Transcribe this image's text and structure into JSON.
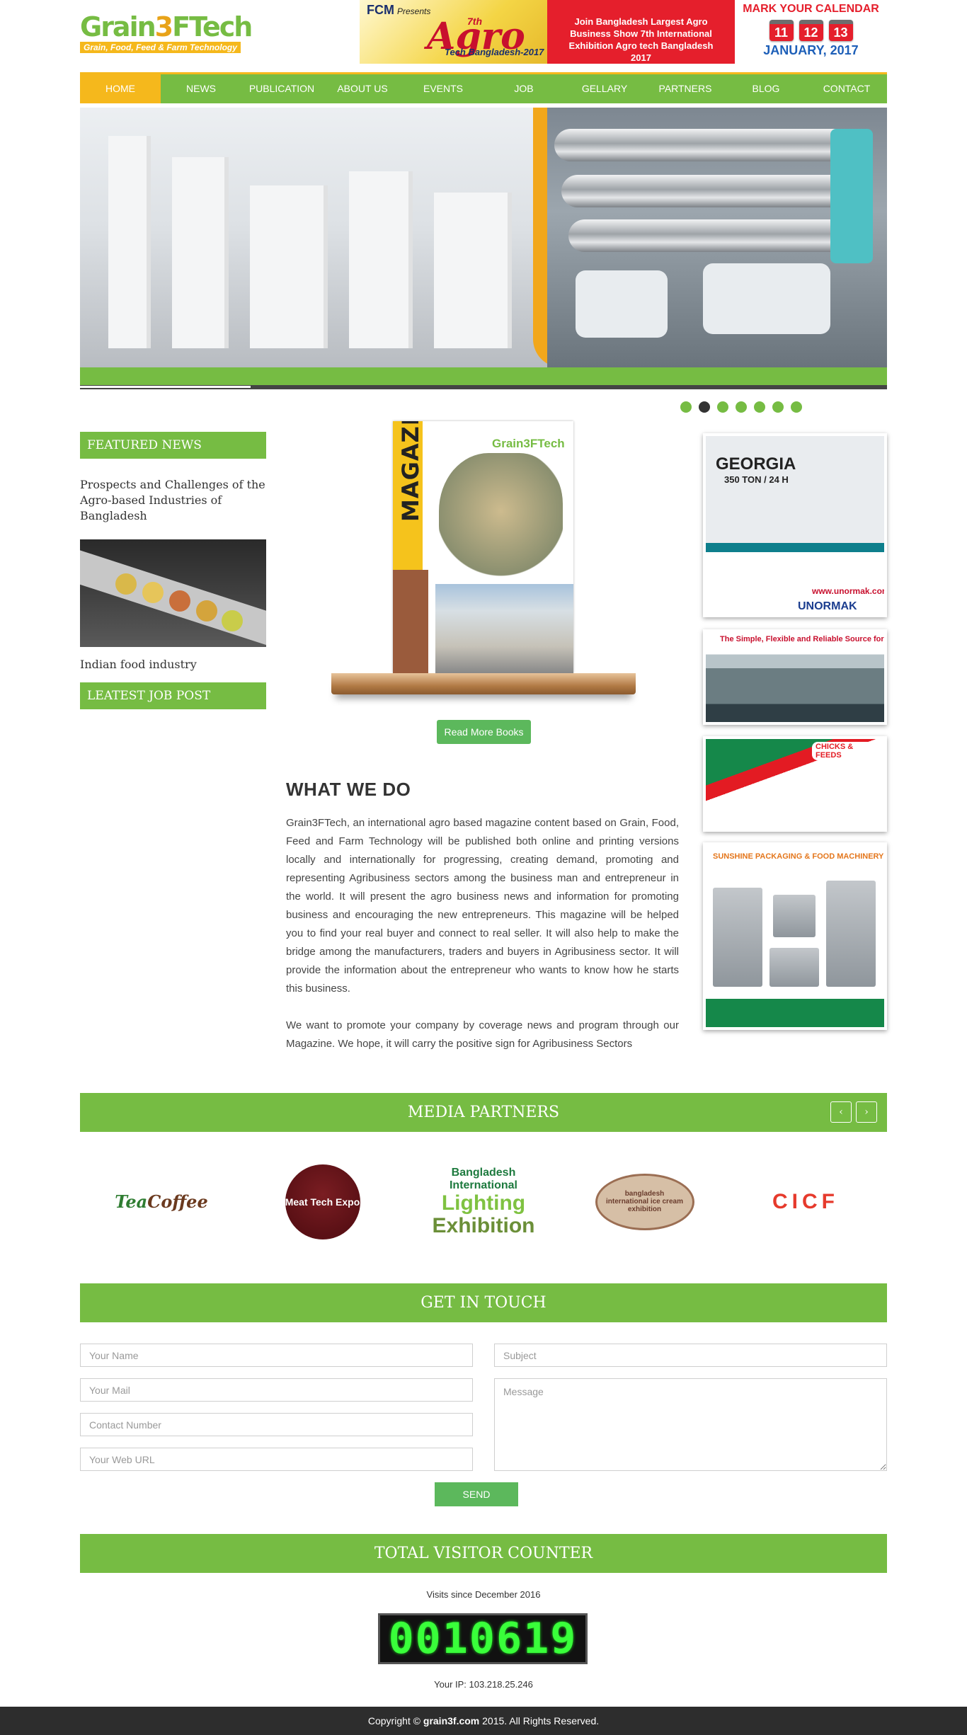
{
  "logo": {
    "name_a": "Grain",
    "name_b": "3",
    "name_c": "FTech",
    "tagline": "Grain, Food, Feed & Farm Technology"
  },
  "banner": {
    "fcm": "FCM",
    "presents": "Presents",
    "seventh": "7th",
    "agro": "Agro",
    "sub": "Tech Bangladesh-2017",
    "join_text": "Join Bangladesh Largest Agro Business Show 7th International Exhibition Agro tech Bangladesh 2017",
    "calendar_head": "MARK YOUR CALENDAR",
    "days": [
      "11",
      "12",
      "13"
    ],
    "month": "JANUARY, 2017"
  },
  "nav": [
    "HOME",
    "NEWS",
    "PUBLICATION",
    "ABOUT US",
    "EVENTS",
    "JOB",
    "GELLARY",
    "PARTNERS",
    "BLOG",
    "CONTACT"
  ],
  "slider": {
    "dot_count": 7,
    "active_dot": 1
  },
  "featured": {
    "heading": "FEATURED NEWS",
    "item1": "Prospects and Challenges of the Agro-based Industries of Bangladesh",
    "item2": "Indian food industry"
  },
  "job": {
    "heading": "LEATEST JOB POST"
  },
  "magazine": {
    "spine": "MAGAZINE",
    "logo": "Grain3FTech",
    "read_more": "Read More Books"
  },
  "what_we_do": {
    "title": "WHAT WE DO",
    "p1": "Grain3FTech, an international agro based magazine content based on Grain, Food, Feed and Farm Technology will be published both online and printing versions locally and internationally for progressing, creating demand, promoting and representing Agribusiness sectors among the business man and entrepreneur in the world. It will present the agro business news and information for promoting business and encouraging the new entrepreneurs. This magazine will be helped you to find your real buyer and connect to real seller. It will also help to make the bridge among the manufacturers, traders and buyers in Agribusiness sector. It will provide the information about the entrepreneur who wants to know how he starts this business.",
    "p2": "We want to promote your company by coverage news and program through our Magazine. We hope, it will carry the positive sign for Agribusiness Sectors"
  },
  "ads": {
    "ad1_title": "GEORGIA",
    "ad1_sub": "350 TON / 24 H",
    "ad1_url": "www.unormak.com.tr",
    "ad1_brand": "UNORMAK",
    "ad2_title": "The Simple, Flexible and Reliable Source for",
    "ad3_brand": "CHICKS & FEEDS",
    "ad4_brand": "SUNSHINE PACKAGING & FOOD MACHINERY"
  },
  "media_partners": {
    "heading": "MEDIA PARTNERS",
    "prev": "‹",
    "next": "›",
    "logos": {
      "tea": "Tea",
      "coffee": "Coffee",
      "meat": "Meat Tech Expo",
      "light_a": "Bangladesh International",
      "light_b": "Lighting",
      "light_c": "Exhibition",
      "ice": "bangladesh international ice cream exhibition",
      "cicf": "CICF"
    }
  },
  "contact": {
    "heading": "GET IN TOUCH",
    "name_ph": "Your Name",
    "mail_ph": "Your Mail",
    "contact_ph": "Contact Number",
    "url_ph": "Your Web URL",
    "subject_ph": "Subject",
    "message_ph": "Message",
    "send": "SEND"
  },
  "counter": {
    "heading": "TOTAL VISITOR COUNTER",
    "since": "Visits since December 2016",
    "value": "0010619",
    "ip_label": "Your IP: 103.218.25.246"
  },
  "footer": {
    "prefix": "Copyright © ",
    "site": "grain3f.com",
    "suffix": " 2015. All Rights Reserved."
  },
  "colors": {
    "green": "#76bc43",
    "yellow": "#f5b81c",
    "button_green": "#5cb85c",
    "footer": "#2d2d2d"
  }
}
